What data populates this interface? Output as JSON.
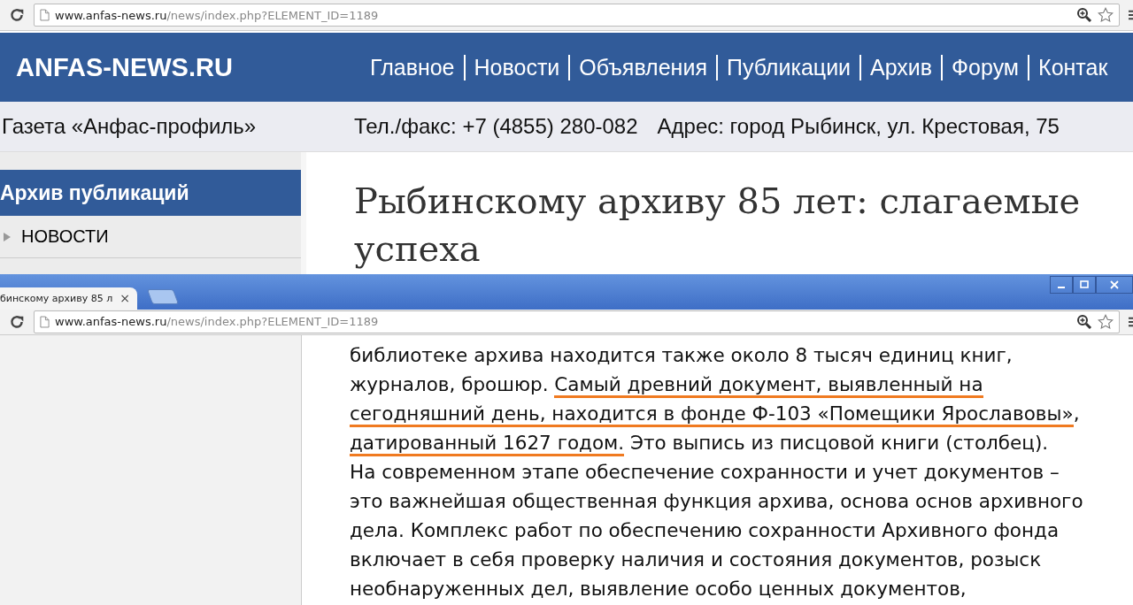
{
  "back_window": {
    "address": {
      "domain": "www.anfas-news.ru",
      "path": "/news/index.php?ELEMENT_ID=1189"
    },
    "site": {
      "logo": "ANFAS-NEWS.RU",
      "nav": [
        "Главное",
        "Новости",
        "Объявления",
        "Публикации",
        "Архив",
        "Форум",
        "Контак"
      ]
    },
    "info_bar": {
      "newspaper": "Газета «Анфас-профиль»",
      "phone": "Тел./факс: +7 (4855) 280-082",
      "address": "Адрес: город Рыбинск, ул. Крестовая, 75"
    },
    "sidebar": {
      "heading": "Архив публикаций",
      "items": [
        "НОВОСТИ"
      ]
    },
    "article_title": "Рыбинскому архиву 85 лет: слагаемые успеха"
  },
  "front_window": {
    "tab": {
      "title": "бинскому архиву 85 л",
      "close": "×"
    },
    "address": {
      "domain": "www.anfas-news.ru",
      "path": "/news/index.php?ELEMENT_ID=1189"
    },
    "article_lines": [
      [
        {
          "text": "библиотеке архива находится также около 8 тысяч единиц книг,",
          "highlighted": false
        }
      ],
      [
        {
          "text": "журналов, брошюр. ",
          "highlighted": false
        },
        {
          "text": "Самый древний документ, выявленный на",
          "highlighted": true
        }
      ],
      [
        {
          "text": "сегодняшний день, находится в фонде Ф-103 «Помещики Ярославовы»",
          "highlighted": true
        },
        {
          "text": ",",
          "highlighted": false
        }
      ],
      [
        {
          "text": "датированный 1627 годом.",
          "highlighted": true
        },
        {
          "text": " Это выпись из писцовой книги (столбец).",
          "highlighted": false
        }
      ],
      [
        {
          "text": "На современном этапе обеспечение сохранности и учет документов –",
          "highlighted": false
        }
      ],
      [
        {
          "text": "это важнейшая общественная функция архива, основа основ архивного",
          "highlighted": false
        }
      ],
      [
        {
          "text": "дела. Комплекс работ по обеспечению сохранности Архивного фонда",
          "highlighted": false
        }
      ],
      [
        {
          "text": "включает в себя проверку наличия и состояния документов, розыск",
          "highlighted": false
        }
      ],
      [
        {
          "text": "необнаруженных дел, выявление особо ценных документов,",
          "highlighted": false
        }
      ]
    ]
  }
}
